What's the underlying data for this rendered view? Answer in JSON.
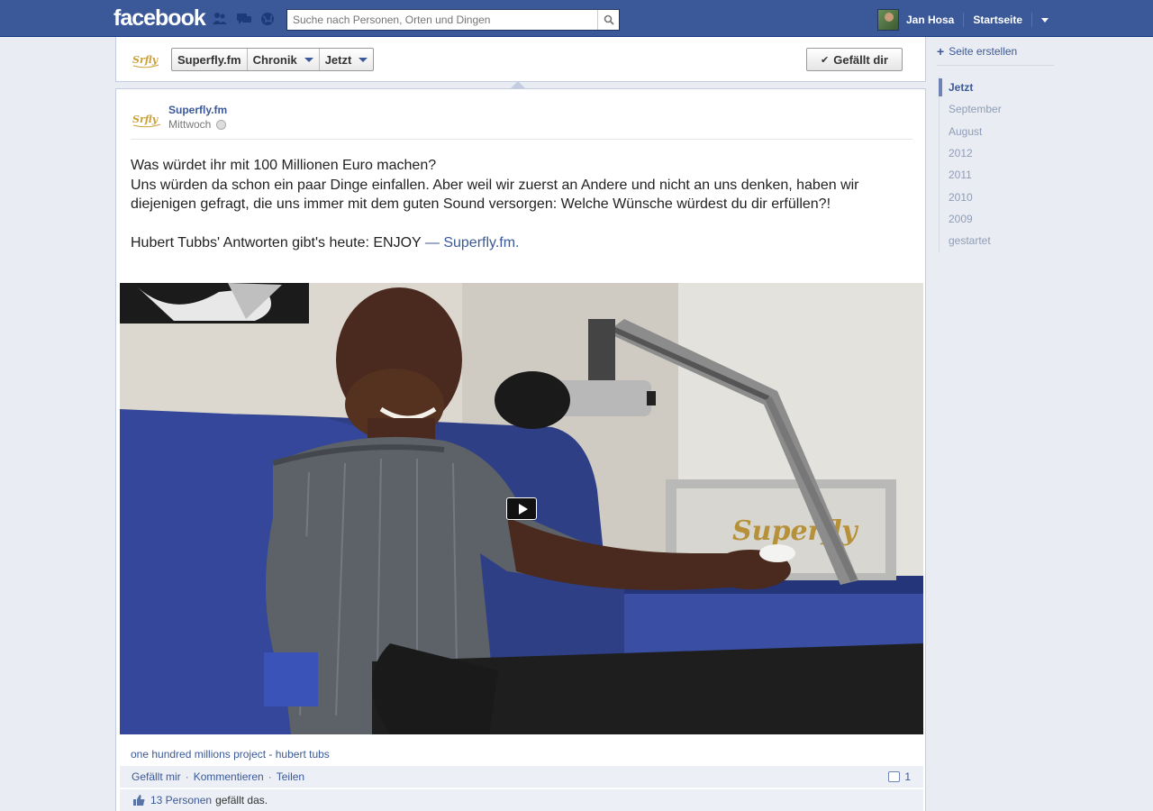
{
  "topbar": {
    "logo": "facebook",
    "search_placeholder": "Suche nach Personen, Orten und Dingen",
    "user_name": "Jan Hosa",
    "home_label": "Startseite"
  },
  "page_header": {
    "crumbs": [
      "Superfly.fm",
      "Chronik",
      "Jetzt"
    ],
    "like_button": "Gefällt dir",
    "logo_text": "Srfly"
  },
  "post": {
    "author": "Superfly.fm",
    "time": "Mittwoch",
    "lines": [
      "Was würdet ihr mit 100 Millionen Euro machen?",
      "Uns würden da schon ein paar Dinge einfallen. Aber weil wir zuerst an Andere und nicht an uns denken, haben wir diejenigen gefragt, die uns immer mit dem guten Sound versorgen: Welche Wünsche würdest du dir erfüllen?!"
    ],
    "footer_line_prefix": "Hubert Tubbs' Antworten gibt's heute: ENJOY",
    "footer_dash": " — ",
    "footer_link": "Superfly.fm.",
    "video_caption": "one hundred millions project - hubert tubs",
    "video_box_text": "Superfly",
    "actions": [
      "Gefällt mir",
      "Kommentieren",
      "Teilen"
    ],
    "comment_count": "1",
    "likes_link": "13 Personen",
    "likes_suffix": "gefällt das."
  },
  "sidebar": {
    "create_page": "Seite erstellen",
    "timeline": [
      "Jetzt",
      "September",
      "August",
      "2012",
      "2011",
      "2010",
      "2009",
      "gestartet"
    ],
    "active_index": 0
  },
  "colors": {
    "brand": "#3b5998",
    "link": "#3b5998",
    "background": "#e9ecf2",
    "sofa": "#2e3f86"
  }
}
